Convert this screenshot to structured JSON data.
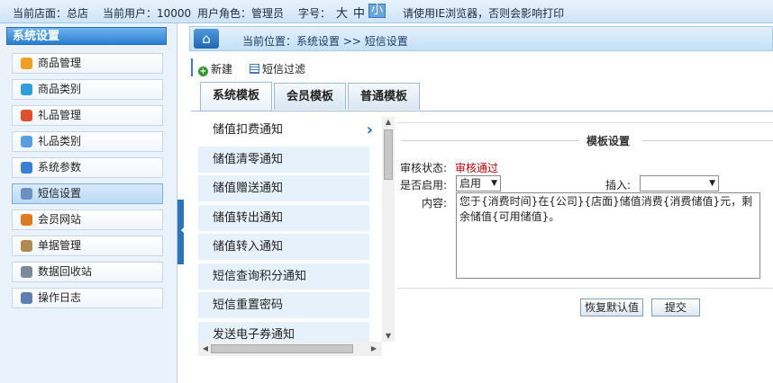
{
  "topbar": {
    "store": "当前店面：总店",
    "user": "当前用户：10000",
    "role": "用户角色：管理员",
    "font_label": "字号：",
    "font_sizes": [
      "大",
      "中",
      "小"
    ],
    "warning": "请使用IE浏览器，否则会影响打印"
  },
  "sidebar": {
    "title": "系统设置",
    "items": [
      {
        "label": "商品管理",
        "icon": "pencil-icon"
      },
      {
        "label": "商品类别",
        "icon": "blocks-icon"
      },
      {
        "label": "礼品管理",
        "icon": "gift-icon"
      },
      {
        "label": "礼品类别",
        "icon": "gift-category-icon"
      },
      {
        "label": "系统参数",
        "icon": "parameters-icon"
      },
      {
        "label": "短信设置",
        "icon": "sms-icon"
      },
      {
        "label": "会员网站",
        "icon": "website-icon"
      },
      {
        "label": "单据管理",
        "icon": "document-icon"
      },
      {
        "label": "数据回收站",
        "icon": "recycle-bin-icon"
      },
      {
        "label": "操作日志",
        "icon": "log-icon"
      }
    ]
  },
  "breadcrumb": "当前位置：系统设置 >> 短信设置",
  "toolbar": {
    "new_label": "新建",
    "filter_label": "短信过滤"
  },
  "tabs": [
    "系统模板",
    "会员模板",
    "普通模板"
  ],
  "templates": [
    "储值扣费通知",
    "储值清零通知",
    "储值赠送通知",
    "储值转出通知",
    "储值转入通知",
    "短信查询积分通知",
    "短信重置密码",
    "发送电子券通知"
  ],
  "panel": {
    "title": "模板设置",
    "status_label": "审核状态:",
    "status_value": "审核通过",
    "enabled_label": "是否启用:",
    "enabled_value": "启用",
    "insert_label": "插入:",
    "insert_value": "",
    "content_label": "内容:",
    "content_value": "您于{消费时间}在{公司}{店面}储值消费{消费储值}元，剩余储值{可用储值}。",
    "restore_label": "恢复默认值",
    "submit_label": "提交"
  },
  "colors": {
    "accent": "#2a7fd0",
    "warning": "#e00000",
    "status_ok": "#c00000"
  }
}
